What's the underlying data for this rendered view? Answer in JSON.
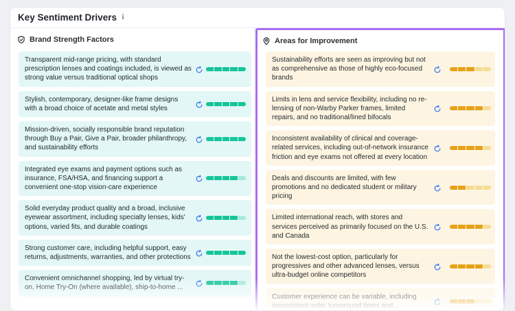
{
  "header": {
    "title": "Key Sentiment Drivers",
    "info_icon": "info-icon"
  },
  "colors": {
    "strength_bg": "#e3f7f6",
    "strength_fill": "#17c59a",
    "strength_empty": "#a6e9da",
    "improve_bg": "#fdf5e2",
    "improve_fill": "#e6a21a",
    "improve_empty": "#f5dc96",
    "accent_border": "#a86df2",
    "icon_blue": "#3b7cf2"
  },
  "strengths": {
    "title": "Brand Strength Factors",
    "icon": "shield-check-icon",
    "items": [
      {
        "text": "Transparent mid-range pricing, with standard prescription lenses and coatings included, is viewed as strong value versus traditional optical shops",
        "level": 1.0
      },
      {
        "text": "Stylish, contemporary, designer-like frame designs with a broad choice of acetate and metal styles",
        "level": 1.0
      },
      {
        "text": "Mission-driven, socially responsible brand reputation through Buy a Pair, Give a Pair, broader philanthropy, and sustainability efforts",
        "level": 1.0
      },
      {
        "text": "Integrated eye exams and payment options such as insurance, FSA/HSA, and financing support a convenient one-stop vision-care experience",
        "level": 0.8
      },
      {
        "text": "Solid everyday product quality and a broad, inclusive eyewear assortment, including specialty lenses, kids' options, varied fits, and durable coatings",
        "level": 0.8
      },
      {
        "text": "Strong customer care, including helpful support, easy returns, adjustments, warranties, and other protections",
        "level": 1.0
      },
      {
        "text": "Convenient omnichannel shopping, led by virtual try-on, Home Try-On (where available), ship-to-home ...",
        "level": 0.8
      }
    ]
  },
  "improvements": {
    "title": "Areas for Improvement",
    "icon": "map-pin-icon",
    "items": [
      {
        "text": "Sustainability efforts are seen as improving but not as comprehensive as those of highly eco-focused brands",
        "level": 0.6
      },
      {
        "text": "Limits in lens and service flexibility, including no re-lensing of non-Warby Parker frames, limited repairs, and no traditional/lined bifocals",
        "level": 0.8
      },
      {
        "text": "Inconsistent availability of clinical and coverage-related services, including out-of-network insurance friction and eye exams not offered at every location",
        "level": 0.8
      },
      {
        "text": "Deals and discounts are limited, with few promotions and no dedicated student or military pricing",
        "level": 0.4
      },
      {
        "text": "Limited international reach, with stores and services perceived as primarily focused on the U.S. and Canada",
        "level": 0.8
      },
      {
        "text": "Not the lowest-cost option, particularly for progressives and other advanced lenses, versus ultra-budget online competitors",
        "level": 0.8
      },
      {
        "text": "Customer experience can be variable, including inconsistent order turnaround times and...",
        "level": 0.6
      }
    ]
  }
}
